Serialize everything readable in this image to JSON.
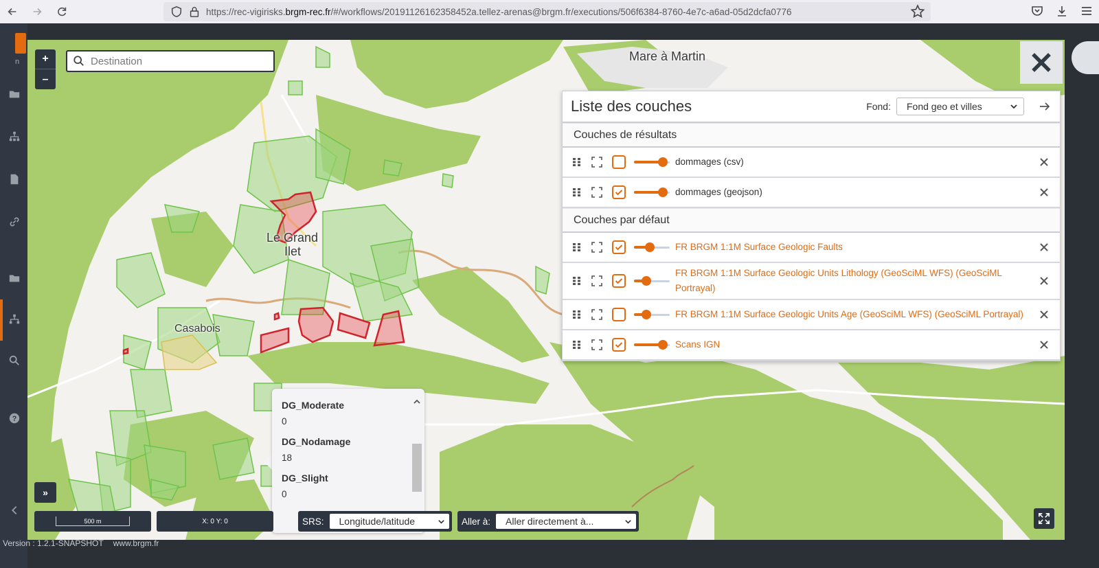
{
  "browser": {
    "url_prefix": "https://rec-vigirisks.",
    "url_domain": "brgm-rec.fr",
    "url_rest": "/#/workflows/20191126162358452a.tellez-arenas@brgm.fr/executions/506f6384-8760-4e7c-a6ad-05d2dcfa0776"
  },
  "app": {
    "logo_letter": "n",
    "version": "Version : 1.2.1-SNAPSHOT",
    "footer_link": "www.brgm.fr"
  },
  "map": {
    "search_placeholder": "Destination",
    "zoom_in": "+",
    "zoom_out": "–",
    "places": [
      "Mare à Martin",
      "Le Grand",
      "Ilet",
      "Casabois"
    ]
  },
  "panel": {
    "title": "Liste des couches",
    "fond_label": "Fond:",
    "fond_value": "Fond geo et villes",
    "sections": [
      {
        "title": "Couches de résultats",
        "layers": [
          {
            "name": "dommages (csv)",
            "checked": false,
            "opacity": 0.8,
            "orange": false
          },
          {
            "name": "dommages (geojson)",
            "checked": true,
            "opacity": 0.8,
            "orange": false
          }
        ]
      },
      {
        "title": "Couches par défaut",
        "layers": [
          {
            "name": "FR BRGM 1:1M Surface Geologic Faults",
            "checked": true,
            "opacity": 0.45,
            "orange": true
          },
          {
            "name": "FR BRGM 1:1M Surface Geologic Units Lithology (GeoSciML WFS) (GeoSciML Portrayal)",
            "checked": true,
            "opacity": 0.35,
            "orange": true
          },
          {
            "name": "FR BRGM 1:1M Surface Geologic Units Age (GeoSciML WFS) (GeoSciML Portrayal)",
            "checked": false,
            "opacity": 0.35,
            "orange": true
          },
          {
            "name": "Scans IGN",
            "checked": true,
            "opacity": 0.8,
            "orange": true
          }
        ]
      }
    ]
  },
  "popup": {
    "items": [
      {
        "key": "DG_Moderate",
        "value": "0"
      },
      {
        "key": "DG_Nodamage",
        "value": "18"
      },
      {
        "key": "DG_Slight",
        "value": "0"
      }
    ]
  },
  "bottom": {
    "scale": "500 m",
    "coords": "X: 0 Y: 0",
    "srs_label": "SRS:",
    "srs_value": "Longitude/latitude",
    "goto_label": "Aller à:",
    "goto_value": "Aller directement à...",
    "expand": "»"
  },
  "colors": {
    "accent": "#e36b10",
    "vegetation": "#a9cd6d",
    "damage_red": "#e63238",
    "building_green": "#9fd67f"
  }
}
